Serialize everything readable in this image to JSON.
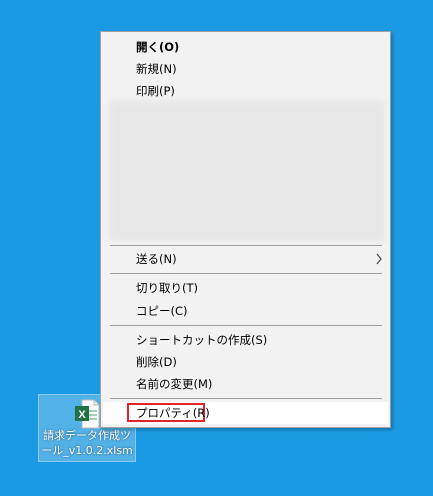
{
  "desktop": {
    "background_color": "#1a9ae3",
    "file": {
      "icon": "excel-file-icon",
      "name": "請求データ作成ツール_v1.0.2.xlsm"
    }
  },
  "context_menu": {
    "items": [
      {
        "label": "開く(O)",
        "bold": true
      },
      {
        "label": "新規(N)"
      },
      {
        "label": "印刷(P)"
      },
      {
        "label": "送る(N)",
        "submenu": true
      },
      {
        "label": "切り取り(T)"
      },
      {
        "label": "コピー(C)"
      },
      {
        "label": "ショートカットの作成(S)"
      },
      {
        "label": "削除(D)"
      },
      {
        "label": "名前の変更(M)"
      },
      {
        "label": "プロパティ(R)",
        "highlighted": true
      }
    ],
    "highlight_color": "#e0242a"
  }
}
